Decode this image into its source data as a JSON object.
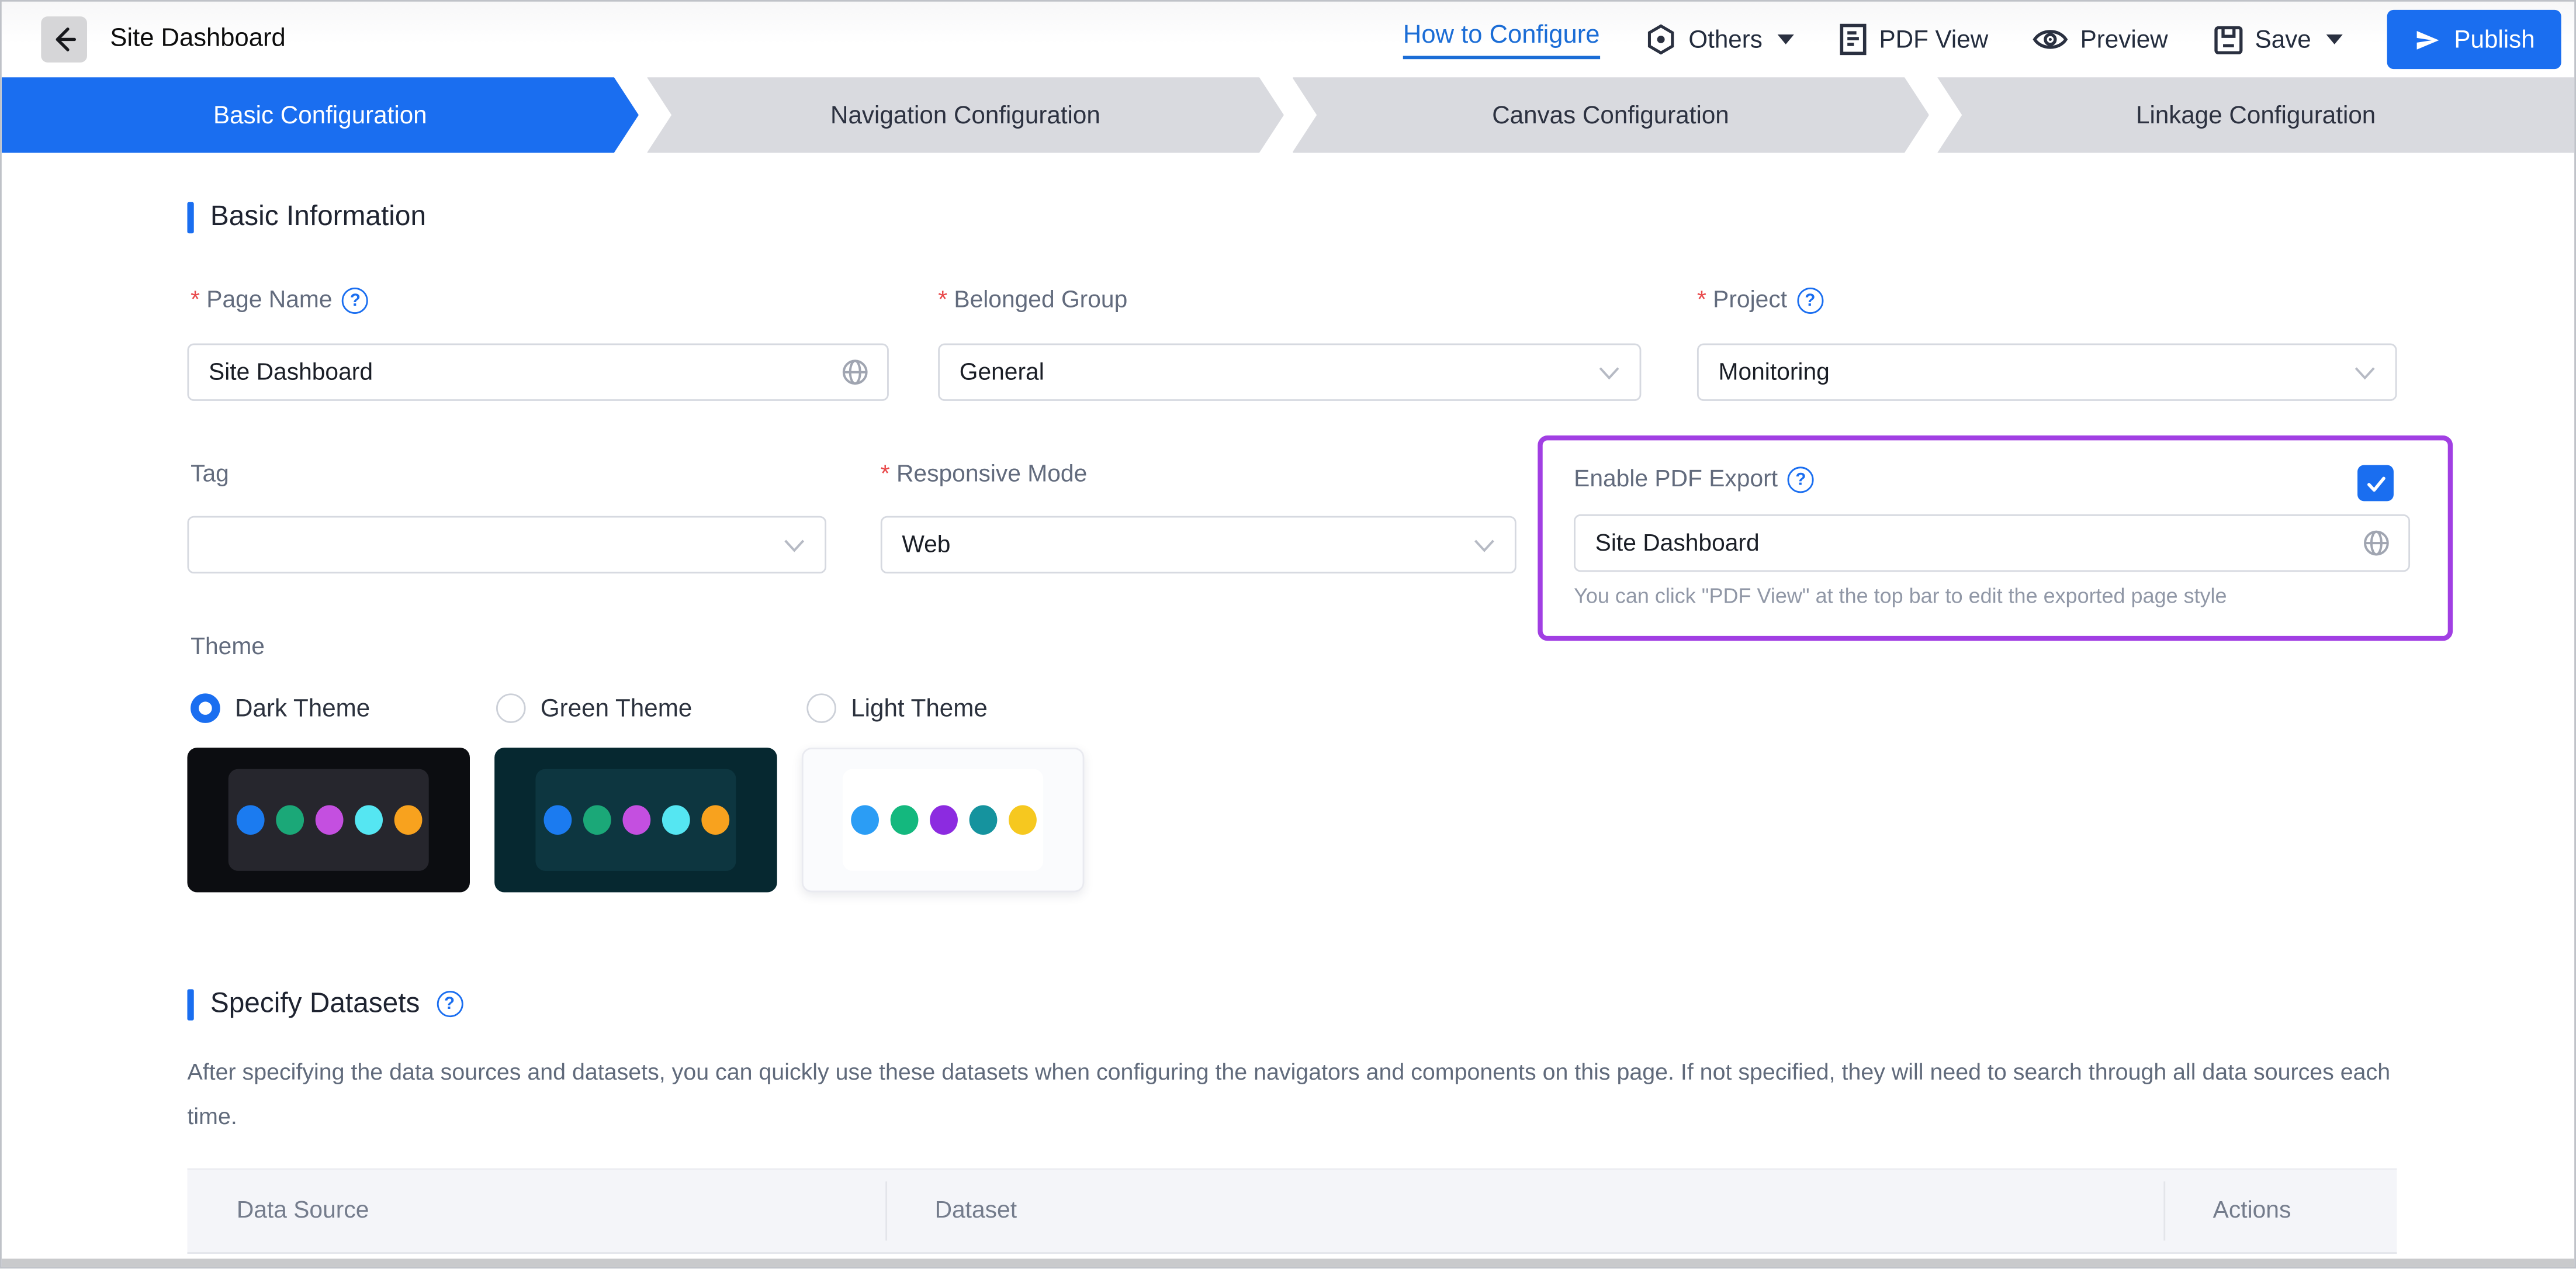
{
  "header": {
    "title": "Site Dashboard",
    "link_how_to_configure": "How to Configure",
    "others_label": "Others",
    "pdf_view_label": "PDF View",
    "preview_label": "Preview",
    "save_label": "Save",
    "publish_label": "Publish"
  },
  "steps": [
    {
      "label": "Basic Configuration",
      "active": true
    },
    {
      "label": "Navigation Configuration",
      "active": false
    },
    {
      "label": "Canvas Configuration",
      "active": false
    },
    {
      "label": "Linkage Configuration",
      "active": false
    }
  ],
  "basic_info": {
    "section_title": "Basic Information",
    "page_name": {
      "label": "Page Name",
      "required": true,
      "value": "Site Dashboard"
    },
    "belonged_group": {
      "label": "Belonged Group",
      "required": true,
      "value": "General"
    },
    "project": {
      "label": "Project",
      "required": true,
      "value": "Monitoring"
    },
    "tag": {
      "label": "Tag",
      "required": false,
      "value": ""
    },
    "responsive_mode": {
      "label": "Responsive Mode",
      "required": true,
      "value": "Web"
    },
    "enable_pdf_export": {
      "label": "Enable PDF Export",
      "checked": true,
      "value": "Site Dashboard",
      "helper": "You can click \"PDF View\" at the top bar to edit the exported page style"
    },
    "theme": {
      "label": "Theme",
      "options": [
        {
          "label": "Dark Theme",
          "selected": true
        },
        {
          "label": "Green Theme",
          "selected": false
        },
        {
          "label": "Light Theme",
          "selected": false
        }
      ],
      "swatches": {
        "dark": {
          "bg": "#0c0d11",
          "panel": "#26262d",
          "dots": [
            "#1b7bf0",
            "#1ba878",
            "#c44fe0",
            "#55e6f2",
            "#f8a21e"
          ]
        },
        "green": {
          "bg": "#062830",
          "panel": "#0d3640",
          "dots": [
            "#1b7bf0",
            "#1ba878",
            "#c44fe0",
            "#55e6f2",
            "#f8a21e"
          ]
        },
        "light": {
          "bg": "#fafbfd",
          "panel": "#ffffff",
          "dots": [
            "#2b9df5",
            "#14b87e",
            "#8c2be0",
            "#15939e",
            "#f6c81f"
          ]
        }
      }
    }
  },
  "datasets": {
    "section_title": "Specify Datasets",
    "description": "After specifying the data sources and datasets, you can quickly use these datasets when configuring the navigators and components on this page. If not specified, they will need to search through all data sources each time.",
    "table": {
      "columns": [
        "Data Source",
        "Dataset",
        "Actions"
      ],
      "rows": []
    }
  },
  "colors": {
    "accent_blue": "#1a6ef0",
    "link_blue": "#1b6dd6",
    "highlight_purple": "#a13fe3",
    "required_red": "#e8484a",
    "step_inactive_bg": "#d9dadf",
    "table_header_bg": "#f4f5f9"
  }
}
